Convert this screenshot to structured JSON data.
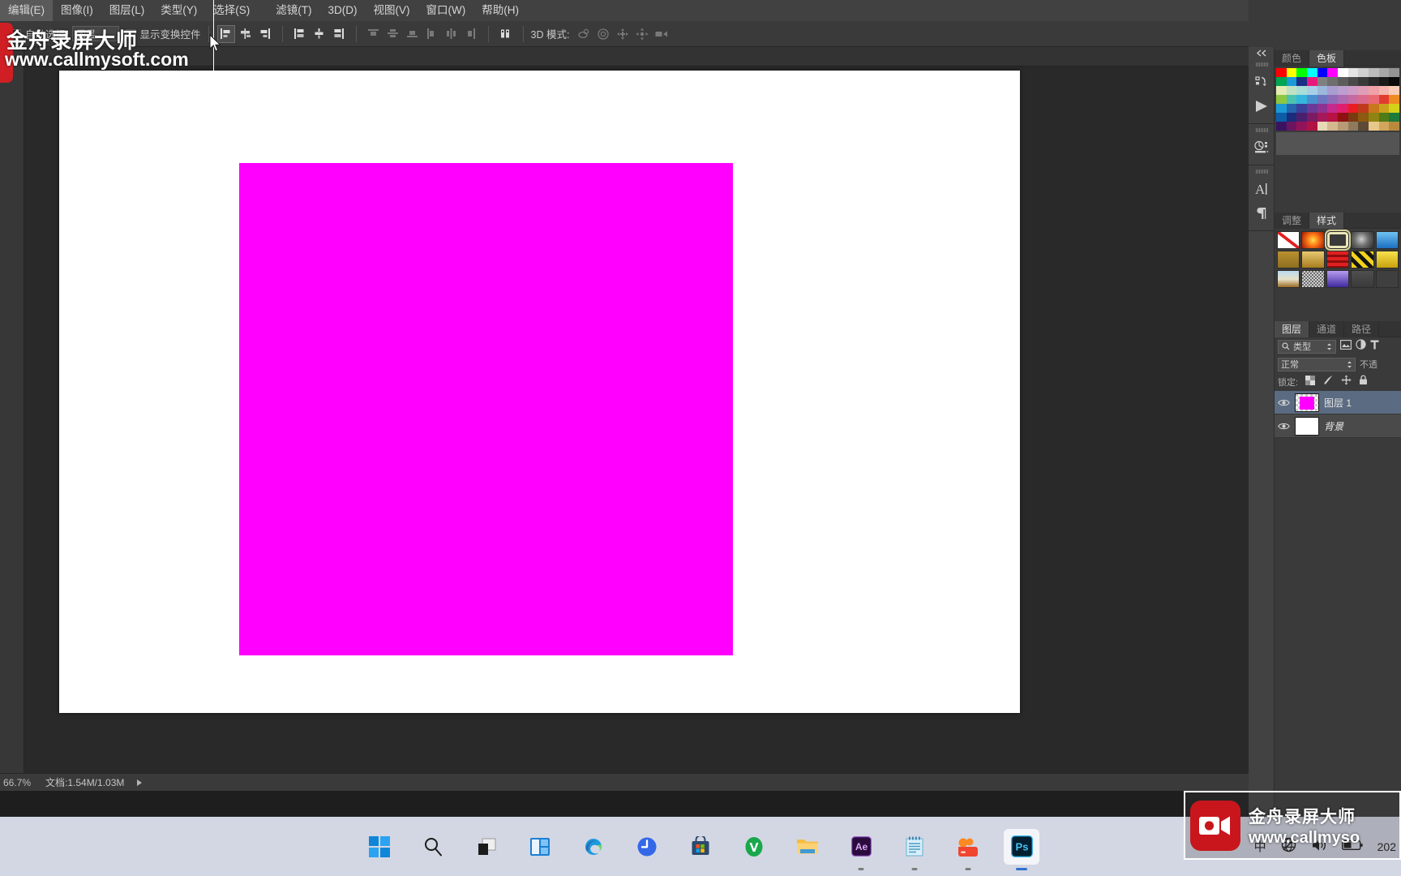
{
  "app": {
    "name": "Adobe Photoshop",
    "locale": "zh-CN"
  },
  "menubar": {
    "items": [
      {
        "label": "编辑(E)",
        "name": "menu-edit"
      },
      {
        "label": "图像(I)",
        "name": "menu-image"
      },
      {
        "label": "图层(L)",
        "name": "menu-layer"
      },
      {
        "label": "类型(Y)",
        "name": "menu-type"
      },
      {
        "label": "选择(S)",
        "name": "menu-select"
      },
      {
        "label": "滤镜(T)",
        "name": "menu-filter"
      },
      {
        "label": "3D(D)",
        "name": "menu-3d"
      },
      {
        "label": "视图(V)",
        "name": "menu-view"
      },
      {
        "label": "窗口(W)",
        "name": "menu-window"
      },
      {
        "label": "帮助(H)",
        "name": "menu-help"
      }
    ]
  },
  "optionsbar": {
    "auto_select_label": "自动选择:",
    "auto_select_value": "图层",
    "show_transform_label": "显示变换控件",
    "mode_3d_label": "3D 模式:",
    "align_icons": [
      "align-left-edges-icon",
      "align-horizontal-centers-icon",
      "align-right-edges-icon",
      "align-top-edges-icon",
      "align-vertical-centers-icon",
      "align-bottom-edges-icon"
    ],
    "distribute_icons": [
      "distribute-top-edges-icon",
      "distribute-vertical-centers-icon",
      "distribute-bottom-edges-icon",
      "distribute-left-edges-icon",
      "distribute-horizontal-centers-icon",
      "distribute-right-edges-icon"
    ],
    "extra_icon": "auto-align-layers-icon",
    "mode_3d_icons": [
      "rotate-3d-object-icon",
      "roll-3d-object-icon",
      "pan-3d-object-icon",
      "slide-3d-object-icon",
      "scale-3d-object-icon"
    ]
  },
  "statusbar": {
    "zoom": "66.7%",
    "doc_info": "文档:1.54M/1.03M",
    "arrow": "play-arrow-icon"
  },
  "icon_dock": {
    "collapse_label": "双箭头折叠",
    "groups": [
      {
        "icons": [
          "history-icon",
          "actions-play-icon"
        ]
      },
      {
        "icons": [
          "3d-panel-icon"
        ]
      },
      {
        "icons": [
          "character-panel-icon",
          "paragraph-panel-icon"
        ]
      }
    ]
  },
  "color_panel": {
    "tabs": [
      {
        "label": "颜色",
        "selected": false
      },
      {
        "label": "色板",
        "selected": true
      }
    ],
    "swatches": [
      [
        "#ff0000",
        "#ffff00",
        "#00ff00",
        "#00ffff",
        "#0000ff",
        "#ff00ff",
        "#ffffff",
        "#e4e4e4",
        "#d0d0d0",
        "#bcbcbc",
        "#a8a8a8",
        "#949494"
      ],
      [
        "#00a651",
        "#1b9ad6",
        "#1a2f87",
        "#e8197d",
        "#808080",
        "#6e6e6e",
        "#5c5c5c",
        "#4a4a4a",
        "#3a3a3a",
        "#2a2a2a",
        "#1a1a1a",
        "#0a0a0a"
      ],
      [
        "#e3ecb2",
        "#bfe2c2",
        "#a9ddd8",
        "#a8cfe8",
        "#9db7dc",
        "#a89ed0",
        "#bd9ed0",
        "#cf9cc6",
        "#e09db6",
        "#eea2a8",
        "#f3b5ae",
        "#f7cbb6"
      ],
      [
        "#8ec63f",
        "#4cc3b0",
        "#35b6dd",
        "#4a8fd0",
        "#6d74c0",
        "#8e6cb8",
        "#ad6bb0",
        "#c76aa2",
        "#d96a8c",
        "#ea6a74",
        "#e23c30",
        "#ef8a22"
      ],
      [
        "#1b9ad6",
        "#2664ae",
        "#3b3f99",
        "#6b3a98",
        "#8e3392",
        "#c42a8c",
        "#e01f6e",
        "#ea1c24",
        "#bf3a1d",
        "#c8781c",
        "#c9a31b",
        "#d4d218"
      ],
      [
        "#0c5ca8",
        "#1b2c7a",
        "#4a1f6d",
        "#7a1b63",
        "#a5185a",
        "#b81144",
        "#8f1111",
        "#7a3b10",
        "#8c5a11",
        "#8f8411",
        "#4f7c16",
        "#1c7a3c"
      ],
      [
        "#3a1360",
        "#6b1560",
        "#93135a",
        "#b01243",
        "#e8d9b7",
        "#d4b98f",
        "#b89a76",
        "#8f7a5c",
        "#5c4a36",
        "#e8c78a",
        "#d2a65c",
        "#b98a3e"
      ]
    ]
  },
  "styles_panel": {
    "tabs": [
      {
        "label": "调整",
        "selected": false
      },
      {
        "label": "样式",
        "selected": true
      }
    ],
    "styles": [
      {
        "name": "none-style",
        "selected": false
      },
      {
        "name": "sunset-glow-style",
        "selected": false
      },
      {
        "name": "hollow-outline-style",
        "selected": true
      },
      {
        "name": "metal-swirl-style",
        "selected": false
      },
      {
        "name": "blue-gradient-style",
        "selected": false
      },
      {
        "name": "gold-matte-style",
        "selected": false
      },
      {
        "name": "gold-shine-style",
        "selected": false
      },
      {
        "name": "red-stripe-style",
        "selected": false
      },
      {
        "name": "yellow-black-style",
        "selected": false
      },
      {
        "name": "yellow-bevel-style",
        "selected": false
      },
      {
        "name": "sky-sand-style",
        "selected": false
      },
      {
        "name": "noise-texture-style",
        "selected": false
      },
      {
        "name": "purple-cube-style",
        "selected": false
      },
      {
        "name": "gray-shadow-style",
        "selected": false
      },
      {
        "name": "empty-style",
        "selected": false
      }
    ]
  },
  "layers_panel": {
    "tabs": [
      {
        "label": "图层",
        "selected": true
      },
      {
        "label": "通道",
        "selected": false
      },
      {
        "label": "路径",
        "selected": false
      }
    ],
    "filter_label": "类型",
    "filter_icons": [
      "image-filter-icon",
      "adjustment-filter-icon",
      "type-filter-icon"
    ],
    "blend_mode": "正常",
    "opacity_label": "不透",
    "lock_label": "锁定:",
    "lock_icons": [
      "lock-transparent-pixels-icon",
      "lock-image-pixels-icon",
      "lock-position-icon",
      "lock-all-icon"
    ],
    "layers": [
      {
        "name": "图层 1",
        "visible": true,
        "selected": true,
        "thumb": "#ff00ff",
        "italic": false
      },
      {
        "name": "背景",
        "visible": true,
        "selected": false,
        "thumb": "#ffffff",
        "italic": true
      }
    ]
  },
  "canvas": {
    "background": "#ffffff",
    "shape_color": "#ff00ff",
    "shape_name": "magenta-rectangle"
  },
  "taskbar": {
    "items": [
      {
        "name": "start-button",
        "label": "开始",
        "running": false,
        "active": false
      },
      {
        "name": "search-icon",
        "label": "搜索",
        "running": false,
        "active": false
      },
      {
        "name": "task-view-icon",
        "label": "任务视图",
        "running": false,
        "active": false
      },
      {
        "name": "widgets-icon",
        "label": "小组件",
        "running": false,
        "active": false
      },
      {
        "name": "edge-icon",
        "label": "Microsoft Edge",
        "running": false,
        "active": false
      },
      {
        "name": "clock-icon",
        "label": "时钟",
        "running": false,
        "active": false
      },
      {
        "name": "microsoft-store-icon",
        "label": "Microsoft Store",
        "running": false,
        "active": false
      },
      {
        "name": "youdao-icon",
        "label": "有道",
        "running": false,
        "active": false
      },
      {
        "name": "file-explorer-icon",
        "label": "文件资源管理器",
        "running": false,
        "active": false
      },
      {
        "name": "after-effects-icon",
        "label": "Ae",
        "running": true,
        "active": false
      },
      {
        "name": "notepad-icon",
        "label": "记事本",
        "running": true,
        "active": false
      },
      {
        "name": "screen-recorder-icon",
        "label": "金舟录屏大师",
        "running": true,
        "active": false
      },
      {
        "name": "photoshop-icon",
        "label": "Ps",
        "running": true,
        "active": true
      }
    ],
    "tray": {
      "ime": "中",
      "network": "network-icon",
      "volume": "volume-icon",
      "battery": "battery-icon",
      "time": "202"
    }
  },
  "watermark": {
    "title": "金舟录屏大师",
    "url": "www.callmysoft.com",
    "url_short": "www.callmyso",
    "logo_name": "video-camera-logo"
  }
}
